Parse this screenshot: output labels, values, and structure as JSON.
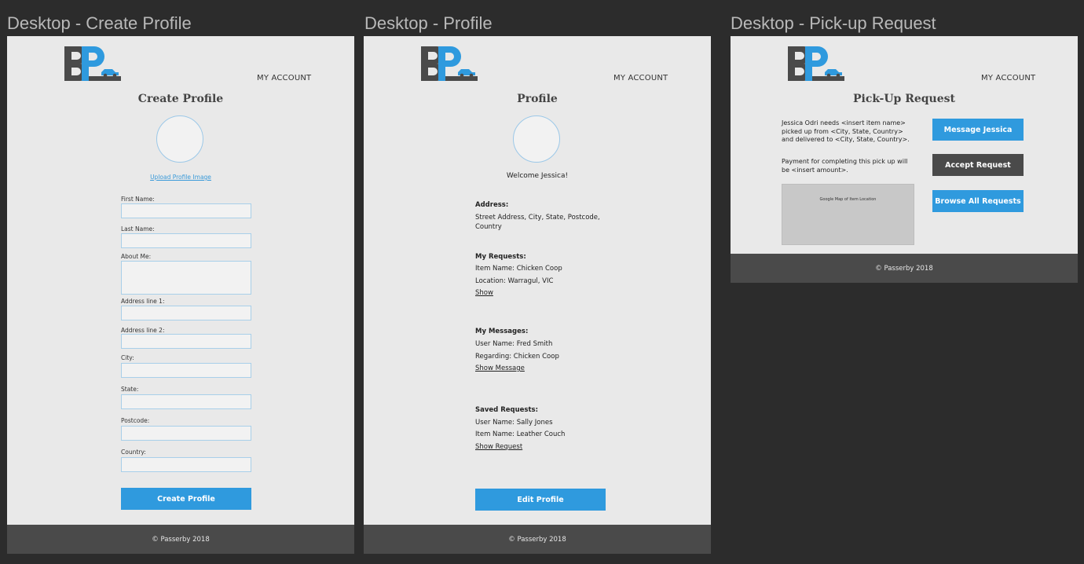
{
  "frames": {
    "create": {
      "artboard_title": "Desktop - Create Profile",
      "my_account": "MY ACCOUNT",
      "heading": "Create Profile",
      "upload_link": "Upload Profile Image",
      "fields": {
        "first_name": "First Name:",
        "last_name": "Last Name:",
        "about_me": "About Me:",
        "address1": "Address line 1:",
        "address2": "Address line 2:",
        "city": "City:",
        "state": "State:",
        "postcode": "Postcode:",
        "country": "Country:"
      },
      "button": "Create Profile",
      "footer": "© Passerby 2018"
    },
    "profile": {
      "artboard_title": "Desktop - Profile",
      "my_account": "MY ACCOUNT",
      "heading": "Profile",
      "welcome": "Welcome Jessica!",
      "address_heading": "Address:",
      "address_line1": "Street Address, City, State, Postcode,",
      "address_line2": "Country",
      "requests_heading": "My Requests:",
      "requests_item": "Item Name: Chicken Coop",
      "requests_location": "Location: Warragul, VIC",
      "requests_link": "Show",
      "messages_heading": "My Messages:",
      "messages_user": "User Name: Fred Smith",
      "messages_regarding": "Regarding: Chicken Coop",
      "messages_link": "Show Message",
      "saved_heading": "Saved Requests:",
      "saved_user": "User Name: Sally Jones",
      "saved_item": "Item Name: Leather Couch",
      "saved_link": "Show Request",
      "button": "Edit Profile",
      "footer": "© Passerby 2018"
    },
    "pickup": {
      "artboard_title": "Desktop - Pick-up Request",
      "my_account": "MY ACCOUNT",
      "heading": "Pick-Up Request",
      "desc_line1": "Jessica Odri needs <insert item name>",
      "desc_line2": "picked up from <City, State, Country>",
      "desc_line3": "and delivered to <City, State, Country>.",
      "payment_line1": "Payment for completing this pick up will",
      "payment_line2": "be <insert amount>.",
      "map_label": "Google Map of Item Location",
      "btn_message": "Message Jessica",
      "btn_accept": "Accept Request",
      "btn_browse": "Browse All Requests",
      "footer": "© Passerby 2018"
    }
  },
  "colors": {
    "background": "#2c2c2c",
    "frame": "#e9e9e9",
    "accent_blue": "#2f9ade",
    "dark_gray": "#4a4a4a"
  },
  "icons": [
    "logo-icon",
    "car-icon"
  ]
}
